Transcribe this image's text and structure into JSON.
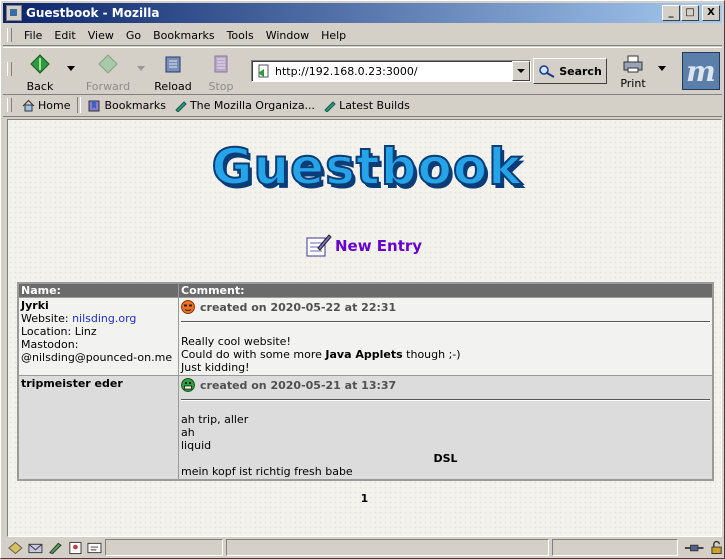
{
  "window": {
    "title": "Guestbook - Mozilla",
    "controls": {
      "minimize": "_",
      "maximize": "□",
      "close": "X"
    }
  },
  "menu": [
    "File",
    "Edit",
    "View",
    "Go",
    "Bookmarks",
    "Tools",
    "Window",
    "Help"
  ],
  "nav": {
    "back": "Back",
    "forward": "Forward",
    "reload": "Reload",
    "stop": "Stop",
    "url": "http://192.168.0.23:3000/",
    "search": "Search",
    "print": "Print",
    "logo": "m"
  },
  "bookmarks": [
    "Home",
    "Bookmarks",
    "The Mozilla Organiza...",
    "Latest Builds"
  ],
  "page": {
    "heading": "Guestbook",
    "new_entry": "New Entry",
    "columns": {
      "name": "Name:",
      "comment": "Comment:"
    },
    "entries": [
      {
        "name": "Jyrki",
        "website_label": "Website:",
        "website": "nilsding.org",
        "location": "Location: Linz",
        "mastodon_label": "Mastodon:",
        "mastodon": "@nilsding@pounced-on.me",
        "created": "created on 2020-05-22 at 22:31",
        "line1": "Really cool website!",
        "line2_pre": "Could do with some more ",
        "line2_bold": "Java Applets",
        "line2_post": " though ;-)",
        "line3": "Just kidding!"
      },
      {
        "name": "tripmeister eder",
        "created": "created on 2020-05-21 at 13:37",
        "line1": "ah trip, aller",
        "line2": "ah",
        "line3": "liquid",
        "centered": "DSL",
        "line4": "mein kopf ist richtig fresh babe"
      }
    ],
    "pagination": "1"
  },
  "colors": {
    "title_gradient_start": "#0a246a",
    "link": "#6600cc",
    "table_header": "#6b6b6b"
  }
}
